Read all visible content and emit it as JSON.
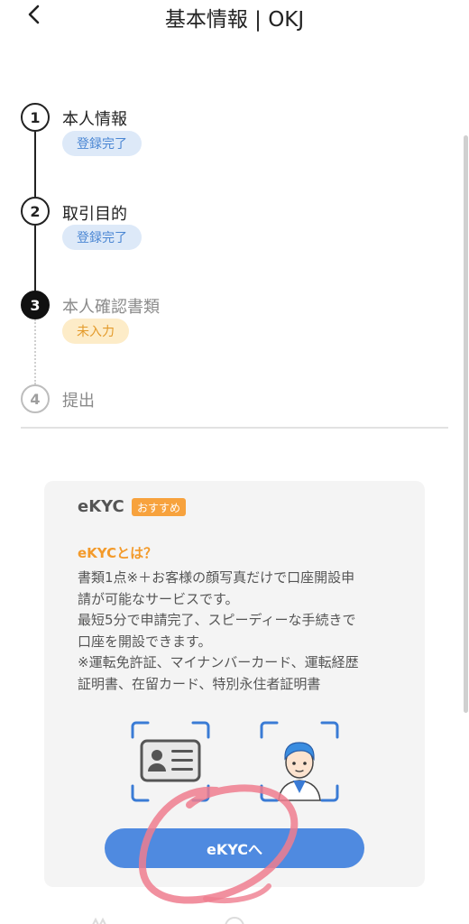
{
  "header": {
    "title": "基本情報 | OKJ",
    "back_icon": "chevron-left-icon"
  },
  "steps": [
    {
      "number": "1",
      "title": "本人情報",
      "status": "登録完了",
      "state": "done"
    },
    {
      "number": "2",
      "title": "取引目的",
      "status": "登録完了",
      "state": "done"
    },
    {
      "number": "3",
      "title": "本人確認書類",
      "status": "未入力",
      "state": "current"
    },
    {
      "number": "4",
      "title": "提出",
      "status": "",
      "state": "pending"
    }
  ],
  "ekyc_card": {
    "title": "eKYC",
    "badge": "おすすめ",
    "what_title": "eKYCとは？",
    "description_lines": [
      "書類1点※＋お客様の顔写真だけで口座開設申",
      "請が可能なサービスです。",
      "最短5分で申請完了、スピーディーな手続きで",
      "口座を開設できます。",
      "※運転免許証、マイナンバーカード、運転経歴",
      "証明書、在留カード、特別永住者証明書"
    ],
    "illustrations": [
      "id-card-icon",
      "person-face-icon"
    ],
    "button_label": "eKYCへ"
  },
  "colors": {
    "accent_blue": "#4f8ae0",
    "done_badge_bg": "#dde9f8",
    "done_badge_text": "#4a86d3",
    "todo_badge_bg": "#fdecc8",
    "todo_badge_text": "#e39a2a",
    "reco_badge": "#f7a23d",
    "annotation_scribble": "#ef7d8e"
  }
}
